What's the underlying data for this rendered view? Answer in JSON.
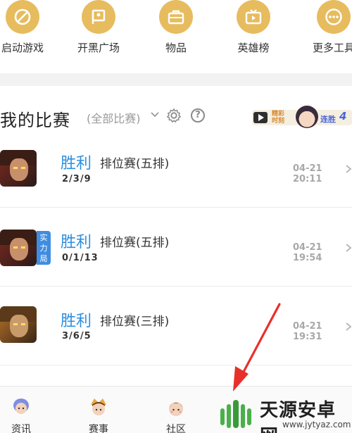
{
  "shortcuts": [
    {
      "label": "启动游戏",
      "icon": "slashed-circle-icon"
    },
    {
      "label": "开黑广场",
      "icon": "flag-icon"
    },
    {
      "label": "物品",
      "icon": "briefcase-icon"
    },
    {
      "label": "英雄榜",
      "icon": "tv-icon"
    },
    {
      "label": "更多工具",
      "icon": "more-dots-icon"
    }
  ],
  "section": {
    "title": "我的比赛",
    "filter": "(全部比赛)",
    "highlight_banner": {
      "text_line1": "精彩",
      "text_line2": "时刻",
      "streak_label": "连胜",
      "streak_count": "4"
    }
  },
  "matches": [
    {
      "result": "胜利",
      "mode": "排位赛(五排)",
      "kda": "2/3/9",
      "time": "04-21 20:11",
      "tag": ""
    },
    {
      "result": "胜利",
      "mode": "排位赛(五排)",
      "kda": "0/1/13",
      "time": "04-21 19:54",
      "tag": "实力局"
    },
    {
      "result": "胜利",
      "mode": "排位赛(三排)",
      "kda": "3/6/5",
      "time": "04-21 19:31",
      "tag": ""
    }
  ],
  "bottom_nav": [
    {
      "label": "资讯"
    },
    {
      "label": "赛事"
    },
    {
      "label": "社区"
    }
  ],
  "watermark": {
    "title": "天源安卓网",
    "url": "www.jytyaz.com"
  },
  "colors": {
    "accent_gold": "#e7bc5f",
    "win_blue": "#2b8fe0",
    "arrow_red": "#e8302a"
  }
}
